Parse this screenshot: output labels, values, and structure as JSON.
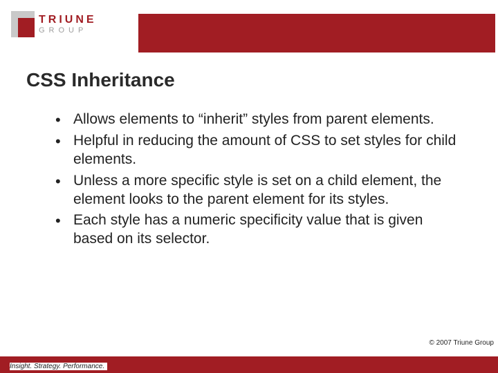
{
  "logo": {
    "top": "TRIUNE",
    "bottom": "GROUP"
  },
  "title": "CSS Inheritance",
  "bullets": [
    "Allows elements to “inherit” styles from parent elements.",
    "Helpful in reducing the amount of CSS to set styles for child elements.",
    "Unless a more specific style is set on a child element, the element looks to the parent element for its styles.",
    "Each style has a numeric specificity value that is given based on its selector."
  ],
  "copyright": "© 2007 Triune Group",
  "tagline": "Insight. Strategy. Performance."
}
